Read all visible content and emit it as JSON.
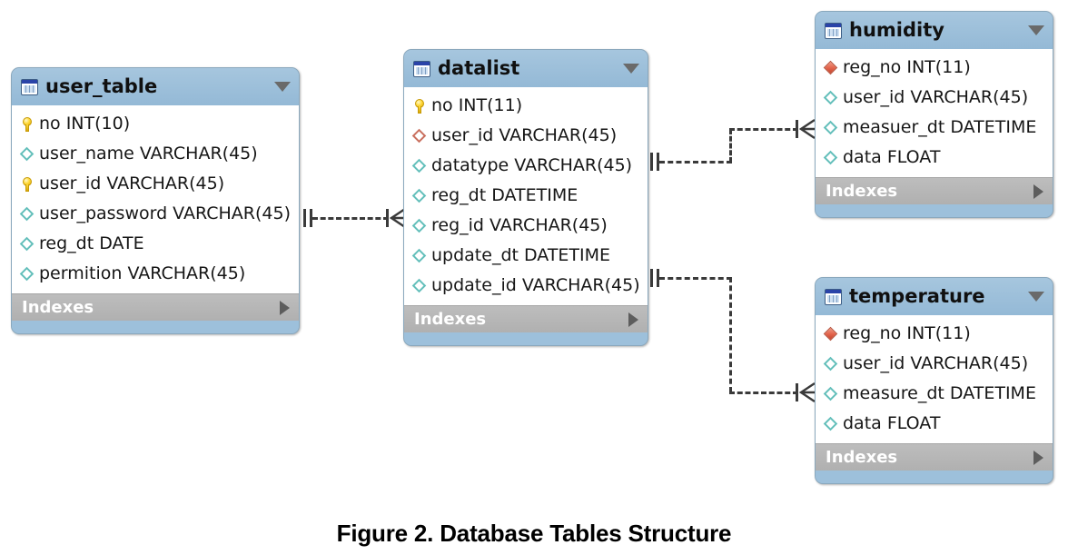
{
  "figure": {
    "caption": "Figure 2. Database Tables Structure"
  },
  "labels": {
    "indexes": "Indexes"
  },
  "icons": {
    "table": "table-icon",
    "collapse": "chevron-down-icon",
    "expand": "chevron-right-icon",
    "primary_key": "key-icon",
    "column": "diamond-icon",
    "foreign_key": "diamond-red-icon",
    "indexed_key": "diamond-filled-red-icon"
  },
  "colors": {
    "header": "#9dc0db",
    "header_gradient_top": "#a6c6de",
    "indexes_bar": "#b0b0b0",
    "field_bg": "#ffffff",
    "key_yellow": "#ffd83a",
    "diamond_teal": "#63bfba",
    "diamond_red": "#c96f5e",
    "diamond_red_fill": "#e2624a",
    "connector": "#3a3a3a"
  },
  "tables": [
    {
      "id": "user_table",
      "name": "user_table",
      "indexes_label": "Indexes",
      "fields": [
        {
          "label": "no INT(10)",
          "marker": "key"
        },
        {
          "label": "user_name VARCHAR(45)",
          "marker": "dia-teal"
        },
        {
          "label": "user_id VARCHAR(45)",
          "marker": "key"
        },
        {
          "label": "user_password VARCHAR(45)",
          "marker": "dia-teal"
        },
        {
          "label": "reg_dt DATE",
          "marker": "dia-teal"
        },
        {
          "label": "permition VARCHAR(45)",
          "marker": "dia-teal"
        }
      ]
    },
    {
      "id": "datalist",
      "name": "datalist",
      "indexes_label": "Indexes",
      "fields": [
        {
          "label": "no INT(11)",
          "marker": "key"
        },
        {
          "label": "user_id VARCHAR(45)",
          "marker": "dia-red"
        },
        {
          "label": "datatype VARCHAR(45)",
          "marker": "dia-teal"
        },
        {
          "label": "reg_dt DATETIME",
          "marker": "dia-teal"
        },
        {
          "label": "reg_id VARCHAR(45)",
          "marker": "dia-teal"
        },
        {
          "label": "update_dt DATETIME",
          "marker": "dia-teal"
        },
        {
          "label": "update_id VARCHAR(45)",
          "marker": "dia-teal"
        }
      ]
    },
    {
      "id": "humidity",
      "name": "humidity",
      "indexes_label": "Indexes",
      "fields": [
        {
          "label": "reg_no INT(11)",
          "marker": "dia-redfill"
        },
        {
          "label": "user_id VARCHAR(45)",
          "marker": "dia-teal"
        },
        {
          "label": "measuer_dt DATETIME",
          "marker": "dia-teal"
        },
        {
          "label": "data FLOAT",
          "marker": "dia-teal"
        }
      ]
    },
    {
      "id": "temperature",
      "name": "temperature",
      "indexes_label": "Indexes",
      "fields": [
        {
          "label": "reg_no INT(11)",
          "marker": "dia-redfill"
        },
        {
          "label": "user_id VARCHAR(45)",
          "marker": "dia-teal"
        },
        {
          "label": "measure_dt DATETIME",
          "marker": "dia-teal"
        },
        {
          "label": "data FLOAT",
          "marker": "dia-teal"
        }
      ]
    }
  ],
  "relationships": [
    {
      "id": "rel-user-datalist",
      "from": "user_table",
      "to": "datalist",
      "from_cardinality": "one",
      "to_cardinality": "many"
    },
    {
      "id": "rel-datalist-humidity",
      "from": "datalist",
      "to": "humidity",
      "from_cardinality": "one",
      "to_cardinality": "many"
    },
    {
      "id": "rel-datalist-temperature",
      "from": "datalist",
      "to": "temperature",
      "from_cardinality": "one",
      "to_cardinality": "many"
    }
  ]
}
